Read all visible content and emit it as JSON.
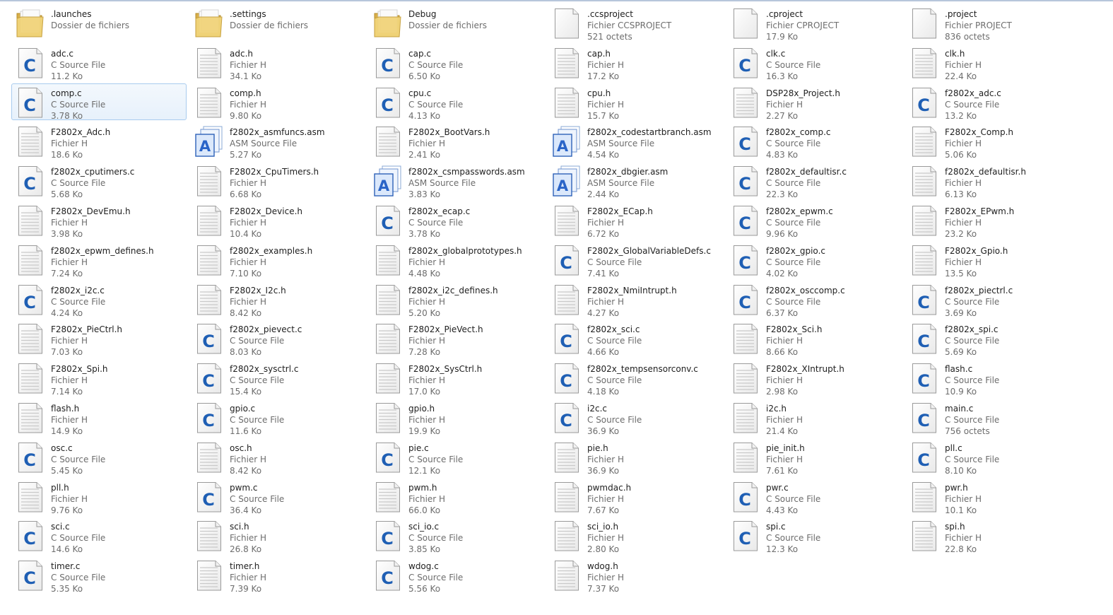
{
  "colors": {
    "selection_bg": "#e7f1fb",
    "selection_border": "#a8cbee",
    "c_letter": "#1f5fb4",
    "folder": "#f1d47a"
  },
  "selected_index": 12,
  "items": [
    {
      "name": ".launches",
      "type": "Dossier de fichiers",
      "size": "",
      "icon": "folder-icon"
    },
    {
      "name": ".settings",
      "type": "Dossier de fichiers",
      "size": "",
      "icon": "folder-icon"
    },
    {
      "name": "Debug",
      "type": "Dossier de fichiers",
      "size": "",
      "icon": "folder-icon"
    },
    {
      "name": ".ccsproject",
      "type": "Fichier CCSPROJECT",
      "size": "521 octets",
      "icon": "blank-file-icon"
    },
    {
      "name": ".cproject",
      "type": "Fichier CPROJECT",
      "size": "17.9 Ko",
      "icon": "blank-file-icon"
    },
    {
      "name": ".project",
      "type": "Fichier PROJECT",
      "size": "836 octets",
      "icon": "blank-file-icon"
    },
    {
      "name": "adc.c",
      "type": "C Source File",
      "size": "11.2 Ko",
      "icon": "c-source-icon"
    },
    {
      "name": "adc.h",
      "type": "Fichier H",
      "size": "34.1 Ko",
      "icon": "text-file-icon"
    },
    {
      "name": "cap.c",
      "type": "C Source File",
      "size": "6.50 Ko",
      "icon": "c-source-icon"
    },
    {
      "name": "cap.h",
      "type": "Fichier H",
      "size": "17.2 Ko",
      "icon": "text-file-icon"
    },
    {
      "name": "clk.c",
      "type": "C Source File",
      "size": "16.3 Ko",
      "icon": "c-source-icon"
    },
    {
      "name": "clk.h",
      "type": "Fichier H",
      "size": "22.4 Ko",
      "icon": "text-file-icon"
    },
    {
      "name": "comp.c",
      "type": "C Source File",
      "size": "3.78 Ko",
      "icon": "c-source-icon"
    },
    {
      "name": "comp.h",
      "type": "Fichier H",
      "size": "9.80 Ko",
      "icon": "text-file-icon"
    },
    {
      "name": "cpu.c",
      "type": "C Source File",
      "size": "4.13 Ko",
      "icon": "c-source-icon"
    },
    {
      "name": "cpu.h",
      "type": "Fichier H",
      "size": "15.7 Ko",
      "icon": "text-file-icon"
    },
    {
      "name": "DSP28x_Project.h",
      "type": "Fichier H",
      "size": "2.27 Ko",
      "icon": "text-file-icon"
    },
    {
      "name": "f2802x_adc.c",
      "type": "C Source File",
      "size": "13.2 Ko",
      "icon": "c-source-icon"
    },
    {
      "name": "F2802x_Adc.h",
      "type": "Fichier H",
      "size": "18.6 Ko",
      "icon": "text-file-icon"
    },
    {
      "name": "f2802x_asmfuncs.asm",
      "type": "ASM Source File",
      "size": "5.27 Ko",
      "icon": "asm-source-icon"
    },
    {
      "name": "F2802x_BootVars.h",
      "type": "Fichier H",
      "size": "2.41 Ko",
      "icon": "text-file-icon"
    },
    {
      "name": "f2802x_codestartbranch.asm",
      "type": "ASM Source File",
      "size": "4.54 Ko",
      "icon": "asm-source-icon"
    },
    {
      "name": "f2802x_comp.c",
      "type": "C Source File",
      "size": "4.83 Ko",
      "icon": "c-source-icon"
    },
    {
      "name": "F2802x_Comp.h",
      "type": "Fichier H",
      "size": "5.06 Ko",
      "icon": "text-file-icon"
    },
    {
      "name": "f2802x_cputimers.c",
      "type": "C Source File",
      "size": "5.68 Ko",
      "icon": "c-source-icon"
    },
    {
      "name": "F2802x_CpuTimers.h",
      "type": "Fichier H",
      "size": "6.68 Ko",
      "icon": "text-file-icon"
    },
    {
      "name": "f2802x_csmpasswords.asm",
      "type": "ASM Source File",
      "size": "3.83 Ko",
      "icon": "asm-source-icon"
    },
    {
      "name": "f2802x_dbgier.asm",
      "type": "ASM Source File",
      "size": "2.44 Ko",
      "icon": "asm-source-icon"
    },
    {
      "name": "f2802x_defaultisr.c",
      "type": "C Source File",
      "size": "22.3 Ko",
      "icon": "c-source-icon"
    },
    {
      "name": "f2802x_defaultisr.h",
      "type": "Fichier H",
      "size": "6.13 Ko",
      "icon": "text-file-icon"
    },
    {
      "name": "F2802x_DevEmu.h",
      "type": "Fichier H",
      "size": "3.98 Ko",
      "icon": "text-file-icon"
    },
    {
      "name": "F2802x_Device.h",
      "type": "Fichier H",
      "size": "10.4 Ko",
      "icon": "text-file-icon"
    },
    {
      "name": "f2802x_ecap.c",
      "type": "C Source File",
      "size": "3.78 Ko",
      "icon": "c-source-icon"
    },
    {
      "name": "F2802x_ECap.h",
      "type": "Fichier H",
      "size": "6.72 Ko",
      "icon": "text-file-icon"
    },
    {
      "name": "f2802x_epwm.c",
      "type": "C Source File",
      "size": "9.96 Ko",
      "icon": "c-source-icon"
    },
    {
      "name": "F2802x_EPwm.h",
      "type": "Fichier H",
      "size": "23.2 Ko",
      "icon": "text-file-icon"
    },
    {
      "name": "f2802x_epwm_defines.h",
      "type": "Fichier H",
      "size": "7.24 Ko",
      "icon": "text-file-icon"
    },
    {
      "name": "f2802x_examples.h",
      "type": "Fichier H",
      "size": "7.10 Ko",
      "icon": "text-file-icon"
    },
    {
      "name": "f2802x_globalprototypes.h",
      "type": "Fichier H",
      "size": "4.48 Ko",
      "icon": "text-file-icon"
    },
    {
      "name": "F2802x_GlobalVariableDefs.c",
      "type": "C Source File",
      "size": "7.41 Ko",
      "icon": "c-source-icon"
    },
    {
      "name": "f2802x_gpio.c",
      "type": "C Source File",
      "size": "4.02 Ko",
      "icon": "c-source-icon"
    },
    {
      "name": "F2802x_Gpio.h",
      "type": "Fichier H",
      "size": "13.5 Ko",
      "icon": "text-file-icon"
    },
    {
      "name": "f2802x_i2c.c",
      "type": "C Source File",
      "size": "4.24 Ko",
      "icon": "c-source-icon"
    },
    {
      "name": "F2802x_I2c.h",
      "type": "Fichier H",
      "size": "8.42 Ko",
      "icon": "text-file-icon"
    },
    {
      "name": "f2802x_i2c_defines.h",
      "type": "Fichier H",
      "size": "5.20 Ko",
      "icon": "text-file-icon"
    },
    {
      "name": "F2802x_NmiIntrupt.h",
      "type": "Fichier H",
      "size": "4.27 Ko",
      "icon": "text-file-icon"
    },
    {
      "name": "f2802x_osccomp.c",
      "type": "C Source File",
      "size": "6.37 Ko",
      "icon": "c-source-icon"
    },
    {
      "name": "f2802x_piectrl.c",
      "type": "C Source File",
      "size": "3.69 Ko",
      "icon": "c-source-icon"
    },
    {
      "name": "F2802x_PieCtrl.h",
      "type": "Fichier H",
      "size": "7.03 Ko",
      "icon": "text-file-icon"
    },
    {
      "name": "f2802x_pievect.c",
      "type": "C Source File",
      "size": "8.03 Ko",
      "icon": "c-source-icon"
    },
    {
      "name": "F2802x_PieVect.h",
      "type": "Fichier H",
      "size": "7.28 Ko",
      "icon": "text-file-icon"
    },
    {
      "name": "f2802x_sci.c",
      "type": "C Source File",
      "size": "4.66 Ko",
      "icon": "c-source-icon"
    },
    {
      "name": "F2802x_Sci.h",
      "type": "Fichier H",
      "size": "8.66 Ko",
      "icon": "text-file-icon"
    },
    {
      "name": "f2802x_spi.c",
      "type": "C Source File",
      "size": "5.69 Ko",
      "icon": "c-source-icon"
    },
    {
      "name": "F2802x_Spi.h",
      "type": "Fichier H",
      "size": "7.14 Ko",
      "icon": "text-file-icon"
    },
    {
      "name": "f2802x_sysctrl.c",
      "type": "C Source File",
      "size": "15.4 Ko",
      "icon": "c-source-icon"
    },
    {
      "name": "F2802x_SysCtrl.h",
      "type": "Fichier H",
      "size": "17.0 Ko",
      "icon": "text-file-icon"
    },
    {
      "name": "f2802x_tempsensorconv.c",
      "type": "C Source File",
      "size": "4.18 Ko",
      "icon": "c-source-icon"
    },
    {
      "name": "F2802x_XIntrupt.h",
      "type": "Fichier H",
      "size": "2.98 Ko",
      "icon": "text-file-icon"
    },
    {
      "name": "flash.c",
      "type": "C Source File",
      "size": "10.9 Ko",
      "icon": "c-source-icon"
    },
    {
      "name": "flash.h",
      "type": "Fichier H",
      "size": "14.9 Ko",
      "icon": "text-file-icon"
    },
    {
      "name": "gpio.c",
      "type": "C Source File",
      "size": "11.6 Ko",
      "icon": "c-source-icon"
    },
    {
      "name": "gpio.h",
      "type": "Fichier H",
      "size": "19.9 Ko",
      "icon": "text-file-icon"
    },
    {
      "name": "i2c.c",
      "type": "C Source File",
      "size": "36.9 Ko",
      "icon": "c-source-icon"
    },
    {
      "name": "i2c.h",
      "type": "Fichier H",
      "size": "21.4 Ko",
      "icon": "text-file-icon"
    },
    {
      "name": "main.c",
      "type": "C Source File",
      "size": "756 octets",
      "icon": "c-source-icon"
    },
    {
      "name": "osc.c",
      "type": "C Source File",
      "size": "5.45 Ko",
      "icon": "c-source-icon"
    },
    {
      "name": "osc.h",
      "type": "Fichier H",
      "size": "8.42 Ko",
      "icon": "text-file-icon"
    },
    {
      "name": "pie.c",
      "type": "C Source File",
      "size": "12.1 Ko",
      "icon": "c-source-icon"
    },
    {
      "name": "pie.h",
      "type": "Fichier H",
      "size": "36.9 Ko",
      "icon": "text-file-icon"
    },
    {
      "name": "pie_init.h",
      "type": "Fichier H",
      "size": "7.61 Ko",
      "icon": "text-file-icon"
    },
    {
      "name": "pll.c",
      "type": "C Source File",
      "size": "8.10 Ko",
      "icon": "c-source-icon"
    },
    {
      "name": "pll.h",
      "type": "Fichier H",
      "size": "9.76 Ko",
      "icon": "text-file-icon"
    },
    {
      "name": "pwm.c",
      "type": "C Source File",
      "size": "36.4 Ko",
      "icon": "c-source-icon"
    },
    {
      "name": "pwm.h",
      "type": "Fichier H",
      "size": "66.0 Ko",
      "icon": "text-file-icon"
    },
    {
      "name": "pwmdac.h",
      "type": "Fichier H",
      "size": "7.67 Ko",
      "icon": "text-file-icon"
    },
    {
      "name": "pwr.c",
      "type": "C Source File",
      "size": "4.43 Ko",
      "icon": "c-source-icon"
    },
    {
      "name": "pwr.h",
      "type": "Fichier H",
      "size": "10.1 Ko",
      "icon": "text-file-icon"
    },
    {
      "name": "sci.c",
      "type": "C Source File",
      "size": "14.6 Ko",
      "icon": "c-source-icon"
    },
    {
      "name": "sci.h",
      "type": "Fichier H",
      "size": "26.8 Ko",
      "icon": "text-file-icon"
    },
    {
      "name": "sci_io.c",
      "type": "C Source File",
      "size": "3.85 Ko",
      "icon": "c-source-icon"
    },
    {
      "name": "sci_io.h",
      "type": "Fichier H",
      "size": "2.80 Ko",
      "icon": "text-file-icon"
    },
    {
      "name": "spi.c",
      "type": "C Source File",
      "size": "12.3 Ko",
      "icon": "c-source-icon"
    },
    {
      "name": "spi.h",
      "type": "Fichier H",
      "size": "22.8 Ko",
      "icon": "text-file-icon"
    },
    {
      "name": "timer.c",
      "type": "C Source File",
      "size": "5.35 Ko",
      "icon": "c-source-icon"
    },
    {
      "name": "timer.h",
      "type": "Fichier H",
      "size": "7.39 Ko",
      "icon": "text-file-icon"
    },
    {
      "name": "wdog.c",
      "type": "C Source File",
      "size": "5.56 Ko",
      "icon": "c-source-icon"
    },
    {
      "name": "wdog.h",
      "type": "Fichier H",
      "size": "7.37 Ko",
      "icon": "text-file-icon"
    }
  ]
}
